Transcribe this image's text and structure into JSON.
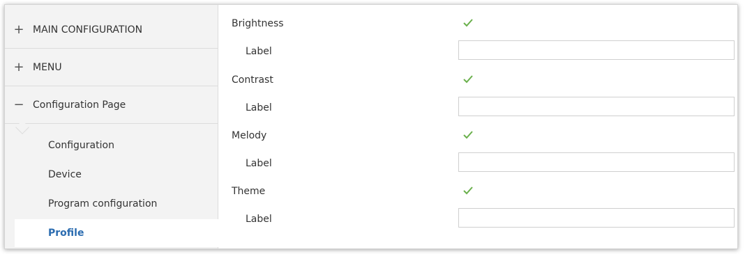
{
  "sidebar": {
    "sections": [
      {
        "sign": "+",
        "label": "MAIN CONFIGURATION"
      },
      {
        "sign": "+",
        "label": "MENU"
      },
      {
        "sign": "−",
        "label": "Configuration Page"
      }
    ],
    "subitems": [
      "Configuration",
      "Device",
      "Program configuration"
    ],
    "active_item": "Profile"
  },
  "content": {
    "rows": [
      {
        "name": "Brightness",
        "checked": true,
        "label": "Label",
        "value": ""
      },
      {
        "name": "Contrast",
        "checked": true,
        "label": "Label",
        "value": ""
      },
      {
        "name": "Melody",
        "checked": true,
        "label": "Label",
        "value": ""
      },
      {
        "name": "Theme",
        "checked": true,
        "label": "Label",
        "value": ""
      }
    ]
  },
  "colors": {
    "check": "#6ab04c",
    "active_text": "#2b6cb0"
  }
}
